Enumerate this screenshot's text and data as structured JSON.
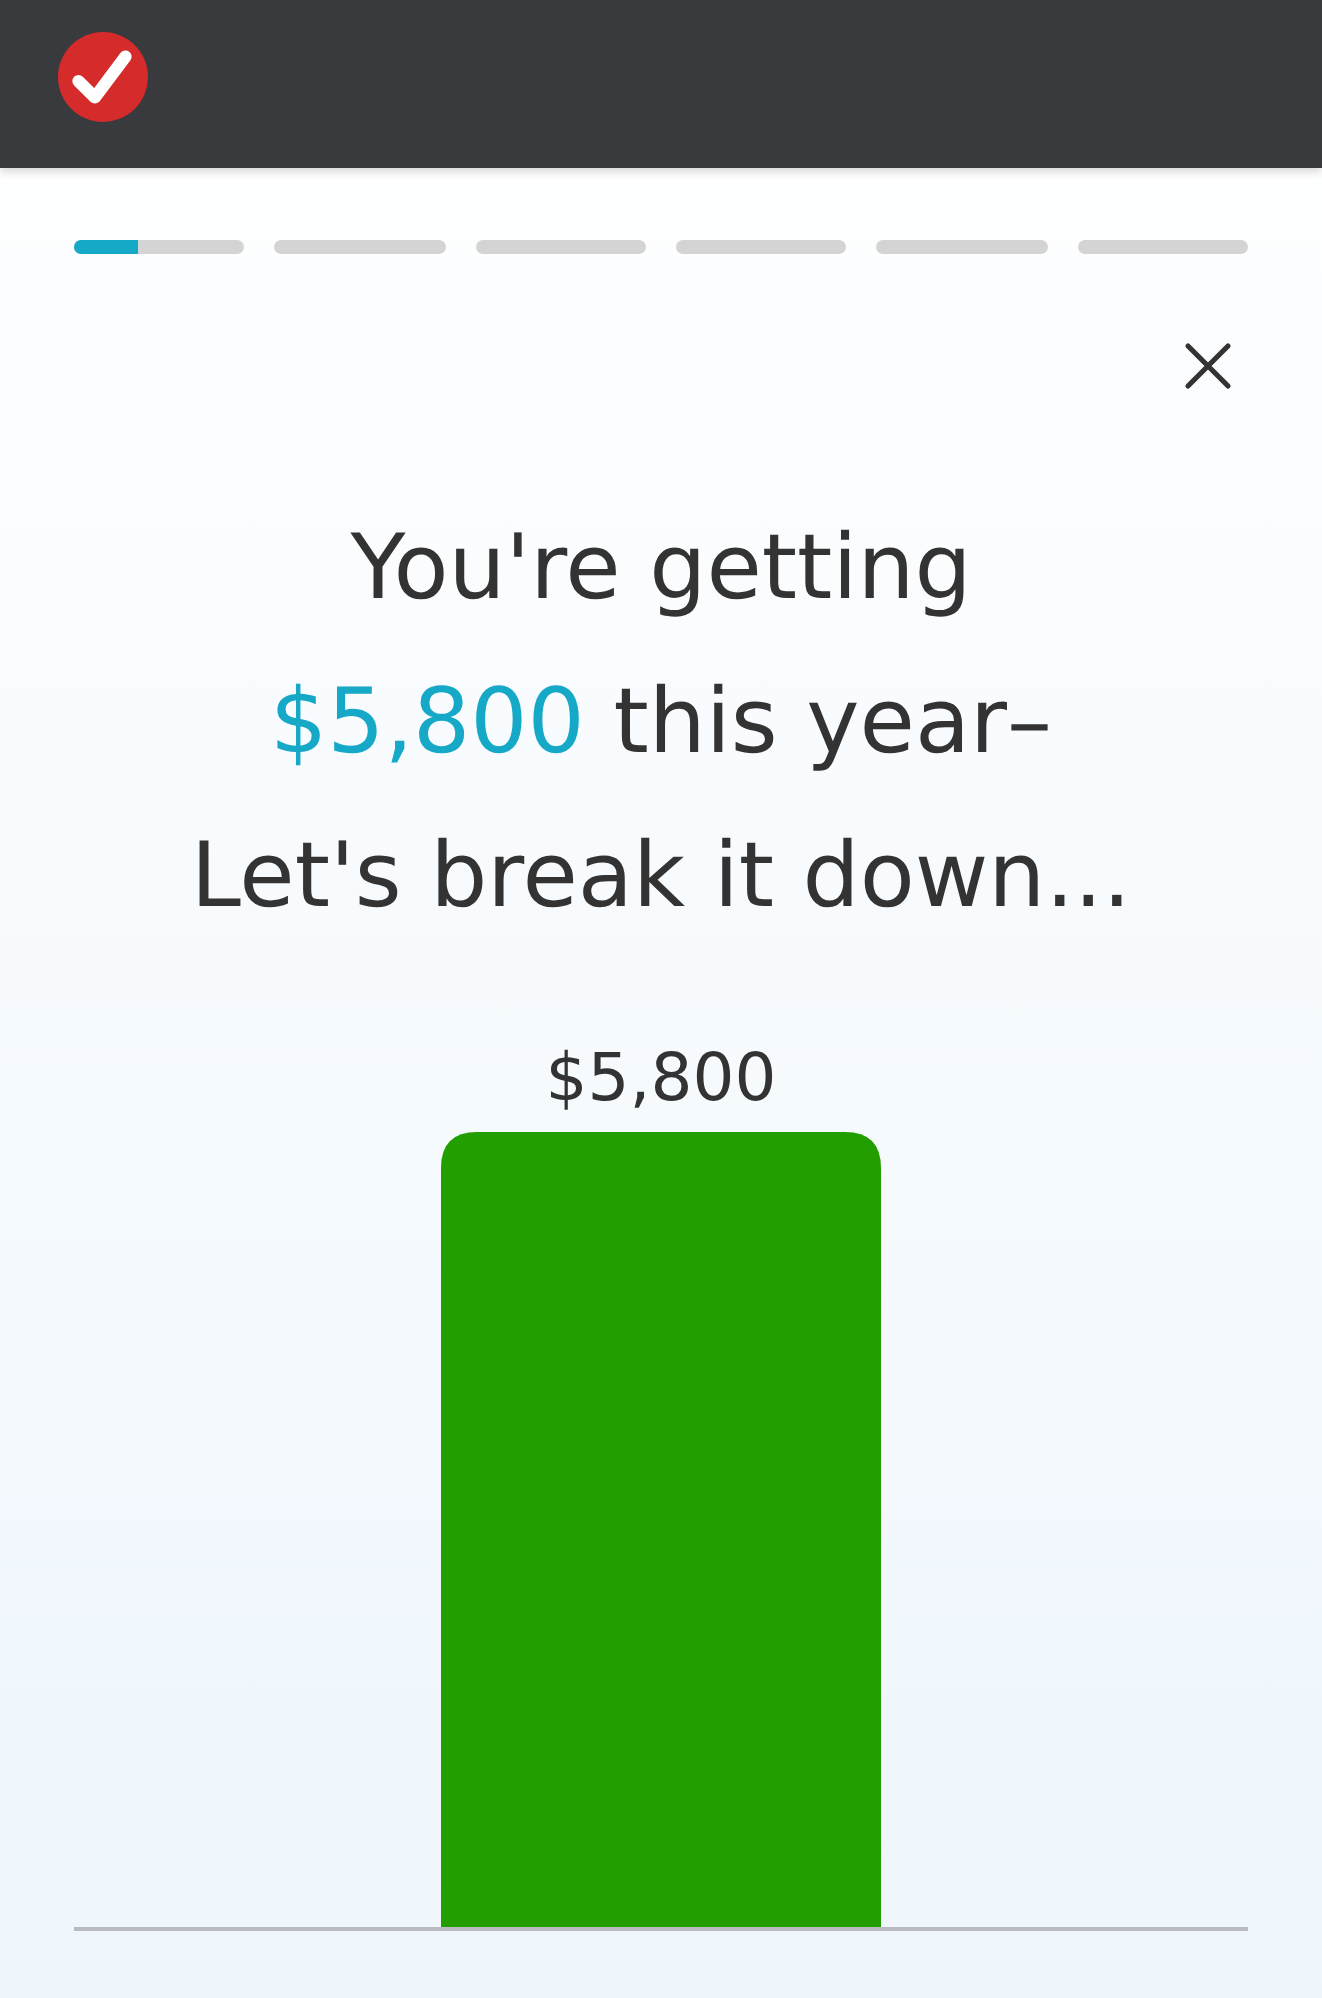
{
  "progress": [
    {
      "level": 0.38
    },
    {
      "level": 0
    },
    {
      "level": 0
    },
    {
      "level": 0
    },
    {
      "level": 0
    },
    {
      "level": 0
    }
  ],
  "headline": {
    "before": "You're getting",
    "amount": "$5,800",
    "after": "this year–",
    "line_3": "Let's break it down..."
  },
  "amount_bar": {
    "label": "$5,800"
  }
}
